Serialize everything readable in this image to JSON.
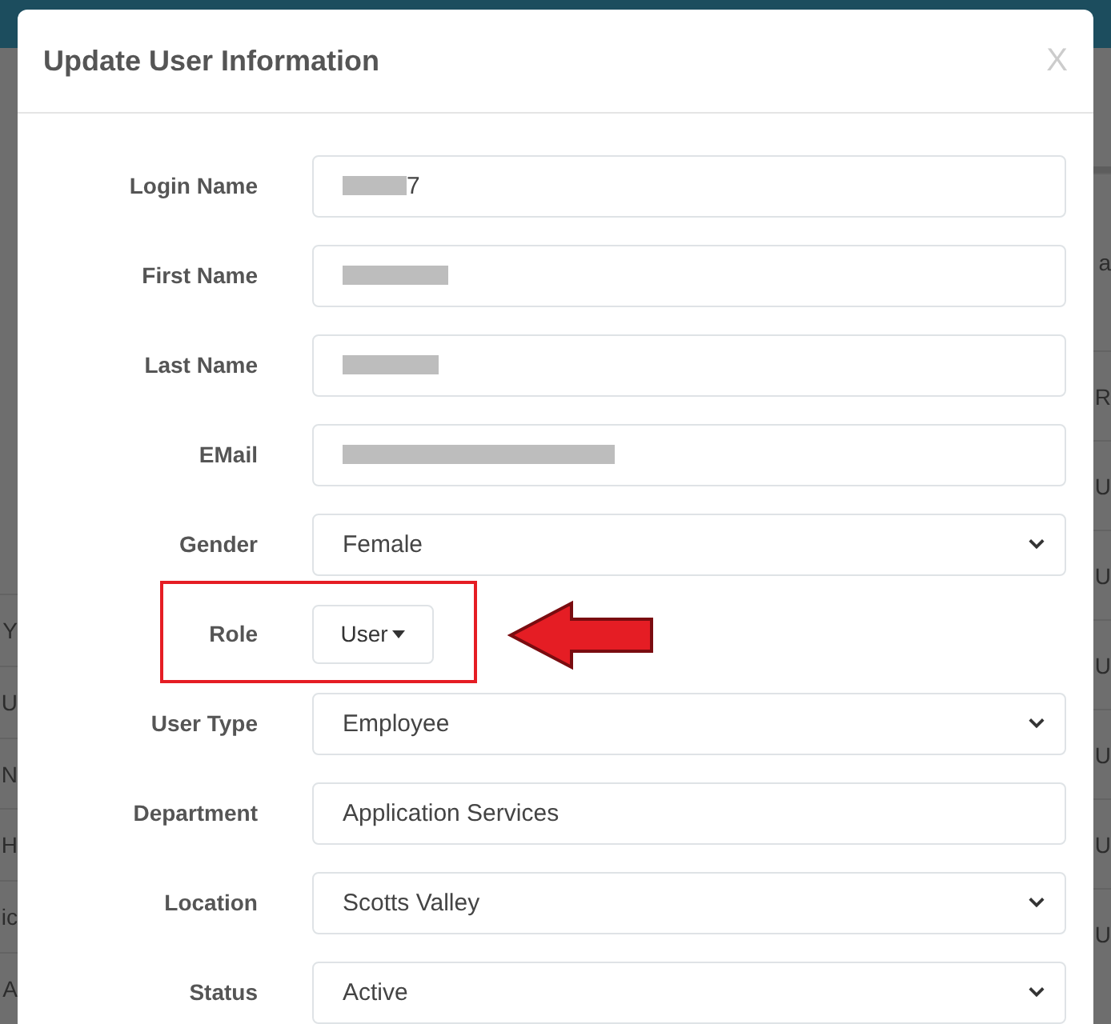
{
  "background_page": {
    "left_fragments": [
      "Y",
      "U",
      "N",
      "H",
      "ic",
      "A"
    ],
    "right_fragments": [
      "a",
      "R",
      "U",
      "U",
      "U",
      "U",
      "U",
      "U"
    ]
  },
  "dialog": {
    "title": "Update User Information",
    "close": "X"
  },
  "fields": [
    {
      "label": "Login Name",
      "kind": "text",
      "redacted": true,
      "value": "7"
    },
    {
      "label": "First Name",
      "kind": "text",
      "redacted": true
    },
    {
      "label": "Last Name",
      "kind": "text",
      "redacted": true
    },
    {
      "label": "EMail",
      "kind": "text",
      "redacted": true
    },
    {
      "label": "Gender",
      "kind": "select",
      "value": "Female"
    },
    {
      "label": "Role",
      "kind": "dropdown-button",
      "value": "User",
      "highlighted": true
    },
    {
      "label": "User Type",
      "kind": "select",
      "value": "Employee"
    },
    {
      "label": "Department",
      "kind": "text",
      "value": "Application Services"
    },
    {
      "label": "Location",
      "kind": "select",
      "value": "Scotts Valley"
    },
    {
      "label": "Status",
      "kind": "select",
      "value": "Active"
    }
  ]
}
